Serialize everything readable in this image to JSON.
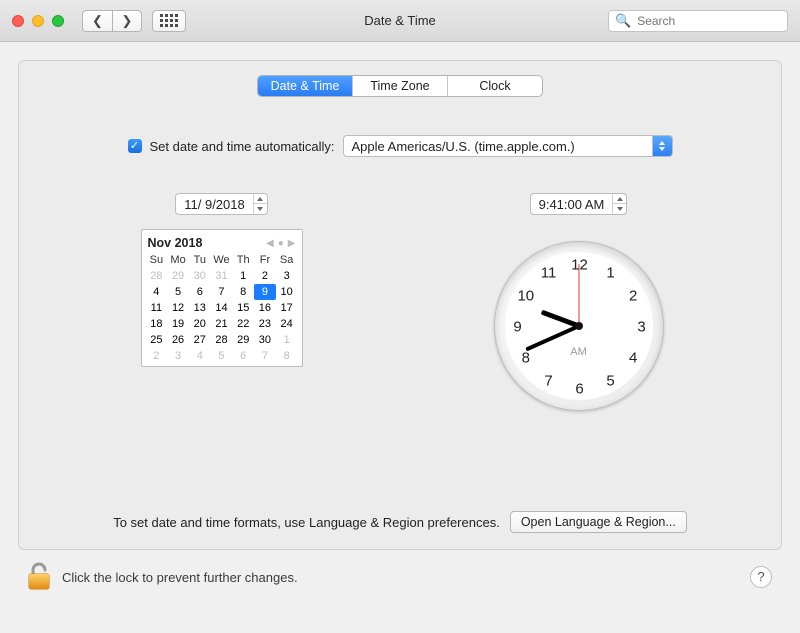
{
  "window": {
    "title": "Date & Time"
  },
  "toolbar": {
    "search_placeholder": "Search"
  },
  "tabs": {
    "t0": "Date & Time",
    "t1": "Time Zone",
    "t2": "Clock"
  },
  "auto": {
    "checked": true,
    "label": "Set date and time automatically:",
    "server": "Apple Americas/U.S. (time.apple.com.)"
  },
  "date_field": "11/  9/2018",
  "time_field": "9:41:00 AM",
  "calendar": {
    "title": "Nov 2018",
    "dow": [
      "Su",
      "Mo",
      "Tu",
      "We",
      "Th",
      "Fr",
      "Sa"
    ],
    "lead_muted": [
      28,
      29,
      30,
      31
    ],
    "days": [
      1,
      2,
      3,
      4,
      5,
      6,
      7,
      8,
      9,
      10,
      11,
      12,
      13,
      14,
      15,
      16,
      17,
      18,
      19,
      20,
      21,
      22,
      23,
      24,
      25,
      26,
      27,
      28,
      29,
      30
    ],
    "trail_muted": [
      1,
      2,
      3,
      4,
      5,
      6,
      7,
      8
    ],
    "selected": 9
  },
  "clock": {
    "numbers": [
      "12",
      "1",
      "2",
      "3",
      "4",
      "5",
      "6",
      "7",
      "8",
      "9",
      "10",
      "11"
    ],
    "ampm": "AM",
    "hour_angle": 290.5,
    "minute_angle": 246.0,
    "second_angle": 0.0
  },
  "formats_hint": "To set date and time formats, use Language & Region preferences.",
  "open_lr_btn": "Open Language & Region...",
  "lock_hint": "Click the lock to prevent further changes.",
  "help_label": "?"
}
